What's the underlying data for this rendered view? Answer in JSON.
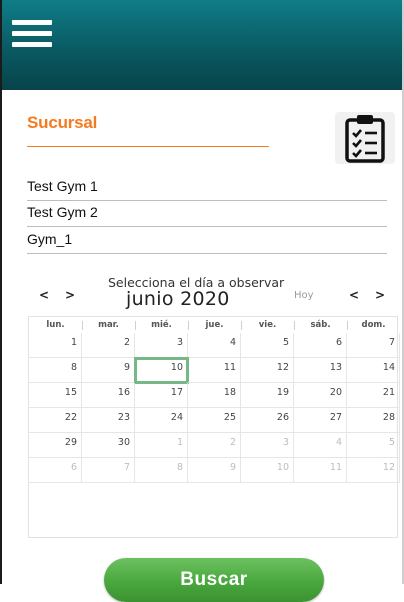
{
  "header": {
    "menu_icon": "hamburger-menu-icon",
    "background": "#0a5a63"
  },
  "section": {
    "title": "Sucursal",
    "accent": "#f47b20",
    "action_icon": "clipboard-checklist-icon"
  },
  "branches": [
    {
      "label": "Test Gym 1"
    },
    {
      "label": "Test Gym 2"
    },
    {
      "label": "Gym_1"
    }
  ],
  "calendar": {
    "caption": "Selecciona el día a observar",
    "month_label": "junio 2020",
    "today_label": "Hoy",
    "prev_icon": "chevron-left-icon",
    "next_icon": "chevron-right-icon",
    "weekdays": [
      "lun.",
      "mar.",
      "mié.",
      "jue.",
      "vie.",
      "sáb.",
      "dom."
    ],
    "weeks": [
      [
        "1",
        "2",
        "3",
        "4",
        "5",
        "6",
        "7"
      ],
      [
        "8",
        "9",
        "10",
        "11",
        "12",
        "13",
        "14"
      ],
      [
        "15",
        "16",
        "17",
        "18",
        "19",
        "20",
        "21"
      ],
      [
        "22",
        "23",
        "24",
        "25",
        "26",
        "27",
        "28"
      ],
      [
        "29",
        "30",
        "1",
        "2",
        "3",
        "4",
        "5"
      ],
      [
        "6",
        "7",
        "8",
        "9",
        "10",
        "11",
        "12"
      ]
    ],
    "selected_day": "10",
    "selected_color": "#77b887"
  },
  "actions": {
    "search_label": "Buscar",
    "search_color": "#47a53c"
  }
}
